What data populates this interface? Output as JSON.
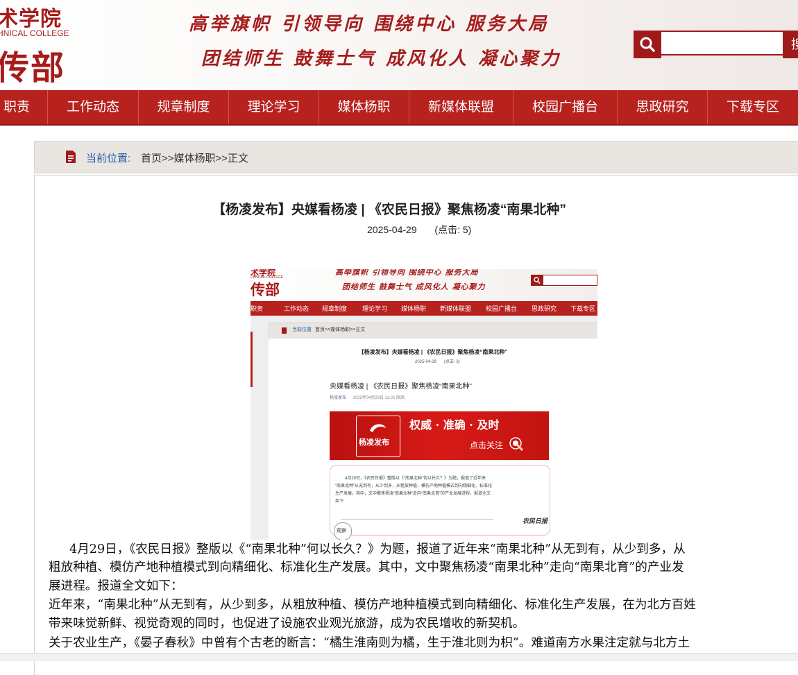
{
  "header": {
    "logo_top": "术学院",
    "logo_en": "HNICAL COLLEGE",
    "logo_big": "传部",
    "slogan_line1": "高举旗帜 引领导向 围绕中心 服务大局",
    "slogan_line2": "团结师生 鼓舞士气 成风化人 凝心聚力",
    "search_placeholder": "",
    "search_go_label": "搜"
  },
  "nav": {
    "items": [
      {
        "label": "职责"
      },
      {
        "label": "工作动态"
      },
      {
        "label": "规章制度"
      },
      {
        "label": "理论学习"
      },
      {
        "label": "媒体杨职"
      },
      {
        "label": "新媒体联盟"
      },
      {
        "label": "校园广播台"
      },
      {
        "label": "思政研究"
      },
      {
        "label": "下载专区"
      }
    ]
  },
  "breadcrumb": {
    "label": "当前位置:",
    "path": "首页>>媒体杨职>>正文"
  },
  "article": {
    "title": "【杨凌发布】央媒看杨凌 | 《农民日报》聚焦杨凌“南果北种”",
    "date": "2025-04-29",
    "clicks": "(点击: 5)",
    "paragraphs": [
      "4月29日，《农民日报》整版以《“南果北种”何以长久？》为题，报道了近年来“南果北种”从无到有，从少到多，从",
      "粗放种植、模仿产地种植模式到向精细化、标准化生产发展。其中，文中聚焦杨凌“南果北种”走向“南果北育”的产业发",
      "展进程。报道全文如下：",
      "近年来，“南果北种”从无到有，从少到多，从粗放种植、模仿产地种植模式到向精细化、标准化生产发展，在为北方百姓",
      "带来味觉新鲜、视觉奇观的同时，也促进了设施农业观光旅游，成为农民增收的新契机。",
      "关于农业生产，《晏子春秋》中曾有个古老的断言：“橘生淮南则为橘，生于淮北则为枳”。难道南方水果注定就与北方土"
    ]
  },
  "embedded_screenshot": {
    "logo_top": "术学院",
    "logo_en": "CHNICAL COLLEGE",
    "logo_big": "传部",
    "slogan_line1": "高举旗帜 引领导向 围绕中心 服务大局",
    "slogan_line2": "团结师生 鼓舞士气 成风化人 凝心聚力",
    "nav": [
      "职责",
      "工作动态",
      "规章制度",
      "理论学习",
      "媒体杨职",
      "新媒体联盟",
      "校园广播台",
      "思政研究",
      "下载专区"
    ],
    "crumb_label": "当前位置",
    "crumb_path": "首页>>媒体杨职>>正文",
    "title": "【杨凌发布】央媒看杨凌 | 《农民日报》聚焦杨凌“南果北种”",
    "date": "2025-04-29",
    "clicks": "(点击: 3)",
    "sub_title": "央媒看杨凌 | 《农民日报》聚焦杨凌“南果北种”",
    "sub_meta_author": "杨凌发布",
    "sub_meta_time": "2025年04月29日 11:32  陕西",
    "banner_brand": "杨凌发布",
    "banner_slogan": "权威 · 准确 · 及时",
    "banner_follow": "点击关注",
    "quote_text_1": "4月29日，《农民日报》整版以《“南果北种”何以长久？》为题，报道了近年来",
    "quote_text_2": "“南果北种”从无到有，从少到多，从粗放种植、模仿产地种植模式到向精细化、标准化",
    "quote_text_3": "生产发展。其中，文中聚焦杨凌“南果北种”走向“南果北育”的产业发展进程。报道全文",
    "quote_text_4": "如下:",
    "newspaper": "农民日报",
    "badge": "观察"
  },
  "colors": {
    "brand_red": "#b7211e",
    "dark_red": "#a0191b",
    "link_blue": "#1f5aa6"
  },
  "icons": {
    "search": "search-icon",
    "breadcrumb": "document-icon"
  }
}
